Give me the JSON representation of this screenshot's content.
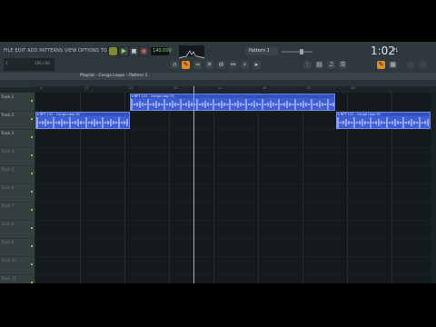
{
  "menu": {
    "text": "FILE EDIT ADD PATTERNS VIEW OPTIONS TOOLS HELP"
  },
  "hint": {
    "left": "1",
    "right": "100 / 60"
  },
  "transport": {
    "tempo": "140.000",
    "pattern_name": "Pattern 1",
    "time": "1:02",
    "time_sub": "71"
  },
  "playlist": {
    "title": "Playlist - Conga Loops › Pattern 1"
  },
  "ruler": {
    "ticks": [
      "9",
      "17",
      "25",
      "33",
      "41",
      "49",
      "57",
      "65"
    ]
  },
  "tracks": [
    {
      "label": "Track 1",
      "active": true
    },
    {
      "label": "Track 2",
      "active": true
    },
    {
      "label": "Track 3",
      "active": true
    },
    {
      "label": "Track 4",
      "active": false
    },
    {
      "label": "Track 5",
      "active": false
    },
    {
      "label": "Track 6",
      "active": false
    },
    {
      "label": "Track 7",
      "active": false
    },
    {
      "label": "Track 8",
      "active": false
    },
    {
      "label": "Track 9",
      "active": false
    },
    {
      "label": "Track 10",
      "active": false
    },
    {
      "label": "Track 11",
      "active": false
    }
  ],
  "clips": [
    {
      "track": 0,
      "start": 0.24,
      "end": 0.76,
      "title": "BPT 122 - Conga Loop 01"
    },
    {
      "track": 1,
      "start": 0.0,
      "end": 0.24,
      "title": "BPT 122 - Conga Loop 01"
    },
    {
      "track": 1,
      "start": 0.76,
      "end": 1.0,
      "title": "BPT 122 - Conga Loop 01"
    }
  ],
  "playhead": {
    "position": 0.4
  },
  "colors": {
    "clip": "#3f5fd6",
    "playhead": "#7bd66b",
    "background": "#141a1c"
  },
  "icons": [
    "play-icon",
    "stop-icon",
    "record-icon",
    "magnet-icon",
    "pencil-icon",
    "brush-icon",
    "delete-icon",
    "mute-icon",
    "slip-icon",
    "zoom-icon",
    "playback-icon",
    "mixer-icon",
    "channel-rack-icon",
    "piano-roll-icon",
    "browser-icon",
    "plugin-icon"
  ]
}
